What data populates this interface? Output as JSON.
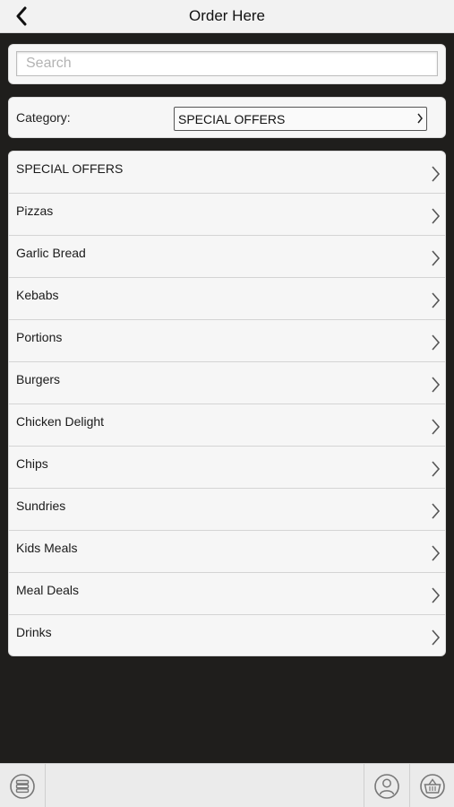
{
  "header": {
    "title": "Order Here",
    "back_icon": "chevron-left-icon"
  },
  "search": {
    "placeholder": "Search",
    "value": ""
  },
  "category": {
    "label": "Category:",
    "selected": "SPECIAL OFFERS"
  },
  "menu": {
    "items": [
      {
        "label": "SPECIAL OFFERS"
      },
      {
        "label": "Pizzas"
      },
      {
        "label": "Garlic Bread"
      },
      {
        "label": "Kebabs"
      },
      {
        "label": "Portions"
      },
      {
        "label": "Burgers"
      },
      {
        "label": "Chicken Delight"
      },
      {
        "label": "Chips"
      },
      {
        "label": "Sundries"
      },
      {
        "label": "Kids Meals"
      },
      {
        "label": "Meal Deals"
      },
      {
        "label": "Drinks"
      }
    ]
  },
  "toolbar": {
    "menu_icon": "menu-stack-icon",
    "account_icon": "user-icon",
    "basket_icon": "basket-icon"
  },
  "colors": {
    "background": "#1f1e1c",
    "panel": "#f6f6f6",
    "header": "#f2f2f2"
  }
}
